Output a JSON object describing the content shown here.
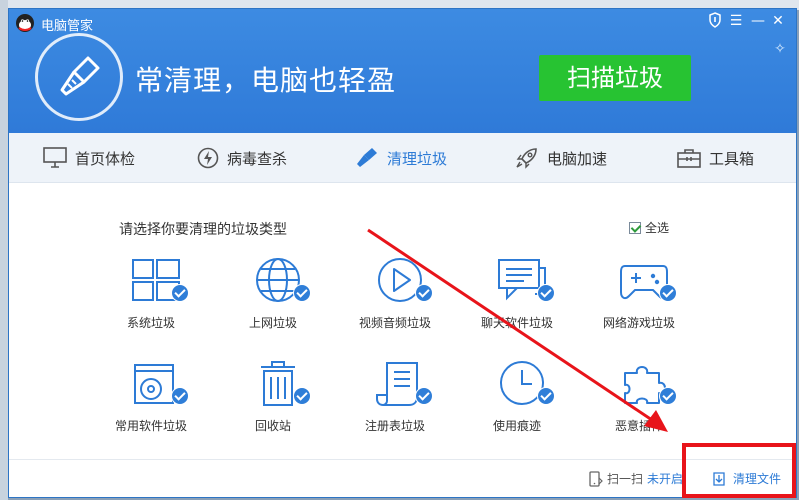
{
  "app": {
    "title": "电脑管家"
  },
  "window_controls": {
    "shield": "shield-icon",
    "menu": "menu-icon",
    "minimize": "minimize-icon",
    "close": "close-icon"
  },
  "hero": {
    "slogan": "常清理，电脑也轻盈",
    "scan_button": "扫描垃圾"
  },
  "nav": {
    "items": [
      {
        "label": "首页体检",
        "icon": "monitor-icon"
      },
      {
        "label": "病毒查杀",
        "icon": "lightning-icon"
      },
      {
        "label": "清理垃圾",
        "icon": "broom-icon",
        "active": true
      },
      {
        "label": "电脑加速",
        "icon": "rocket-icon"
      },
      {
        "label": "工具箱",
        "icon": "toolbox-icon"
      }
    ]
  },
  "content": {
    "title": "请选择你要清理的垃圾类型",
    "select_all": "全选",
    "categories": [
      {
        "label": "系统垃圾",
        "icon": "windows-icon",
        "checked": true
      },
      {
        "label": "上网垃圾",
        "icon": "globe-icon",
        "checked": true
      },
      {
        "label": "视频音频垃圾",
        "icon": "play-icon",
        "checked": true
      },
      {
        "label": "聊天软件垃圾",
        "icon": "chat-icon",
        "checked": true
      },
      {
        "label": "网络游戏垃圾",
        "icon": "gamepad-icon",
        "checked": true
      },
      {
        "label": "常用软件垃圾",
        "icon": "disc-icon",
        "checked": true
      },
      {
        "label": "回收站",
        "icon": "trash-icon",
        "checked": true
      },
      {
        "label": "注册表垃圾",
        "icon": "scroll-icon",
        "checked": true
      },
      {
        "label": "使用痕迹",
        "icon": "clock-icon",
        "checked": true
      },
      {
        "label": "恶意插件",
        "icon": "puzzle-icon",
        "checked": true
      }
    ]
  },
  "footer": {
    "scan_label": "扫一扫",
    "scan_status": "未开启",
    "clean_files": "清理文件"
  },
  "colors": {
    "header": "#3d8be2",
    "scan_button": "#27c332",
    "accent": "#2d7bd6",
    "annotation": "#e8141a"
  }
}
